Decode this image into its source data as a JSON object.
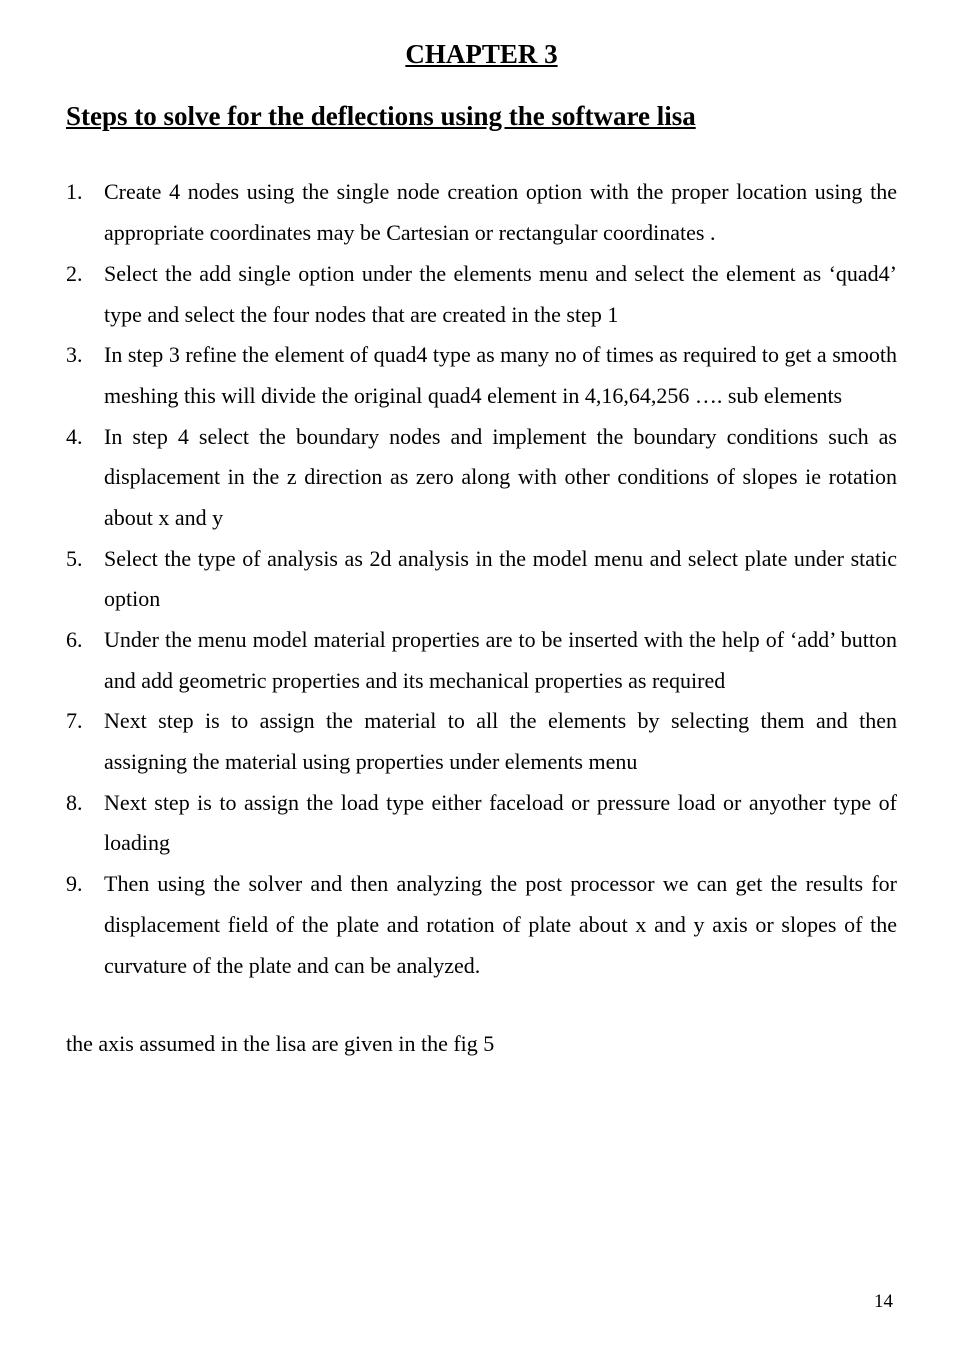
{
  "chapter": "CHAPTER 3",
  "section_title": "Steps to solve for the deflections using the software lisa",
  "steps": [
    "Create 4 nodes using the single node creation option with the proper location using the appropriate coordinates may be Cartesian or rectangular coordinates .",
    "Select the add single option under the elements menu and select the element as ‘quad4’ type and select the four nodes that are created in the step 1",
    "In step 3 refine the element of quad4 type as many no of times as required to get a smooth meshing this will divide the original quad4 element in 4,16,64,256 …. sub elements",
    "In step 4 select the boundary nodes and implement the boundary conditions such as displacement in the z direction as zero along with other conditions of slopes ie rotation about x and y",
    "Select the type of analysis as 2d analysis in the model menu and select plate under static option",
    "Under the menu model material properties are to be inserted with the help of ‘add’ button and add geometric properties and its mechanical properties as required",
    "Next step is to assign the material to all the elements by selecting them and then assigning the material using properties under elements menu",
    "Next step is to assign the load type either faceload or pressure load or anyother type of loading",
    "Then using the solver and then analyzing the post processor we can get the results for displacement field of the plate and rotation of plate about x and y axis or slopes of the curvature of the plate and can be analyzed."
  ],
  "footer": "the axis assumed in the lisa are given in the  fig 5",
  "page_number": "14"
}
